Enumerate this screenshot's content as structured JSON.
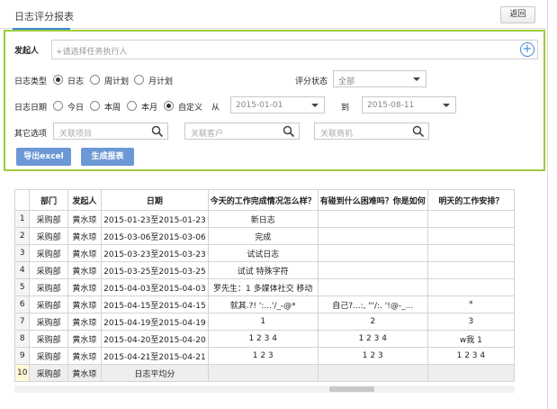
{
  "page": {
    "title": "日志评分报表",
    "back_label": "返回"
  },
  "filters": {
    "initiator_label": "发起人",
    "initiator_placeholder": "+请选择任务执行人",
    "log_type_label": "日志类型",
    "log_type_options": [
      "日志",
      "周计划",
      "月计划"
    ],
    "log_type_selected": "日志",
    "score_status_label": "评分状态",
    "score_status_value": "全部",
    "log_date_label": "日志日期",
    "date_options": [
      "今日",
      "本周",
      "本月",
      "自定义"
    ],
    "date_selected": "自定义",
    "from_label": "从",
    "date_from": "2015-01-01",
    "to_label": "到",
    "date_to": "2015-08-11",
    "other_label": "其它选项",
    "project_placeholder": "关联项目",
    "customer_placeholder": "关联客户",
    "opportunity_placeholder": "关联商机",
    "export_label": "导出excel",
    "generate_label": "生成报表"
  },
  "table": {
    "headers": [
      "",
      "部门",
      "发起人",
      "日期",
      "今天的工作完成情况怎么样？",
      "有碰到什么困难吗？你是如何",
      "明天的工作安排？"
    ],
    "rows": [
      [
        "1",
        "采购部",
        "黄水琼",
        "2015-01-23至2015-01-23",
        "新日志",
        "",
        ""
      ],
      [
        "2",
        "采购部",
        "黄水琼",
        "2015-03-06至2015-03-06",
        "完成",
        "",
        ""
      ],
      [
        "3",
        "采购部",
        "黄水琼",
        "2015-03-23至2015-03-23",
        "试试日志",
        "",
        ""
      ],
      [
        "4",
        "采购部",
        "黄水琼",
        "2015-03-25至2015-03-25",
        "试试 特殊字符",
        "",
        ""
      ],
      [
        "5",
        "采购部",
        "黄水琼",
        "2015-04-03至2015-04-03",
        "罗先生：1 多媒体社交 移动",
        "",
        ""
      ],
      [
        "6",
        "采购部",
        "黄水琼",
        "2015-04-15至2015-04-15",
        "就其.?!  ':...'/_-@*",
        "自己?...:,  \"'/:.  '!@-_...",
        "*"
      ],
      [
        "7",
        "采购部",
        "黄水琼",
        "2015-04-19至2015-04-19",
        "1",
        "2",
        "3"
      ],
      [
        "8",
        "采购部",
        "黄水琼",
        "2015-04-20至2015-04-20",
        "1 2 3 4",
        "1 2 3 4",
        "w我 1"
      ],
      [
        "9",
        "采购部",
        "黄水琼",
        "2015-04-21至2015-04-21",
        "1 2 3",
        "1 2 3",
        "1 2 3 4"
      ]
    ],
    "summary_row": [
      "10",
      "采购部",
      "黄水琼",
      "日志平均分",
      "",
      "",
      ""
    ]
  }
}
